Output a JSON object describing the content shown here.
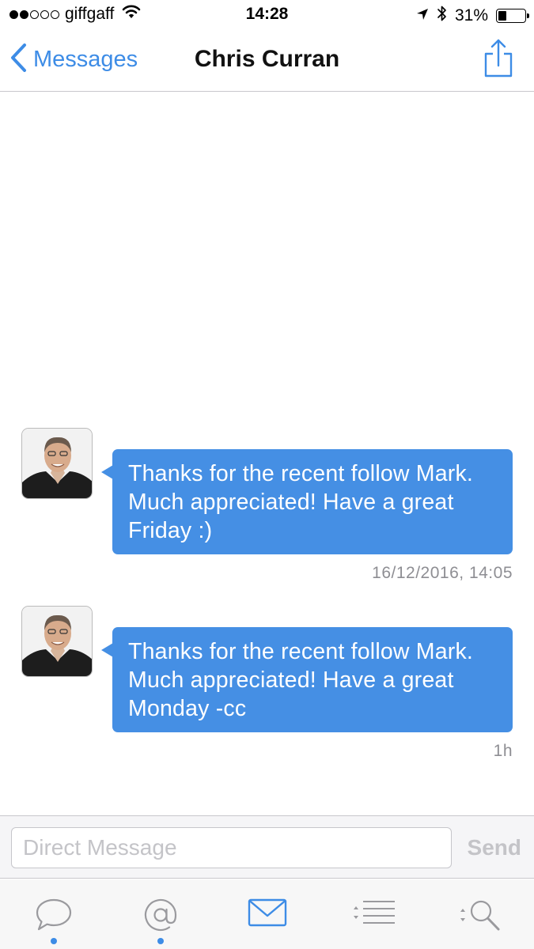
{
  "status_bar": {
    "carrier": "giffgaff",
    "time": "14:28",
    "battery": "31%",
    "battery_level": 0.31,
    "signal_bars_filled": 2,
    "signal_bars_total": 5
  },
  "nav": {
    "back_label": "Messages",
    "title": "Chris Curran"
  },
  "messages": [
    {
      "text": "Thanks for the recent follow Mark. Much appreciated! Have a great Friday :)",
      "time": "16/12/2016, 14:05"
    },
    {
      "text": "Thanks for the recent follow Mark. Much appreciated! Have a great Monday -cc",
      "time": "1h"
    }
  ],
  "composer": {
    "placeholder": "Direct Message",
    "send_label": "Send"
  },
  "tabs": [
    {
      "icon": "speech-bubble-icon",
      "has_dot": true
    },
    {
      "icon": "at-sign-icon",
      "has_dot": true
    },
    {
      "icon": "envelope-icon",
      "has_dot": false,
      "active": true
    },
    {
      "icon": "list-icon",
      "has_dot": false
    },
    {
      "icon": "search-icon",
      "has_dot": false
    }
  ],
  "colors": {
    "accent": "#3d8ce6",
    "bubble": "#458fe4",
    "timestamp": "#8e8e93",
    "inactive_icon": "#9a9a9e"
  }
}
